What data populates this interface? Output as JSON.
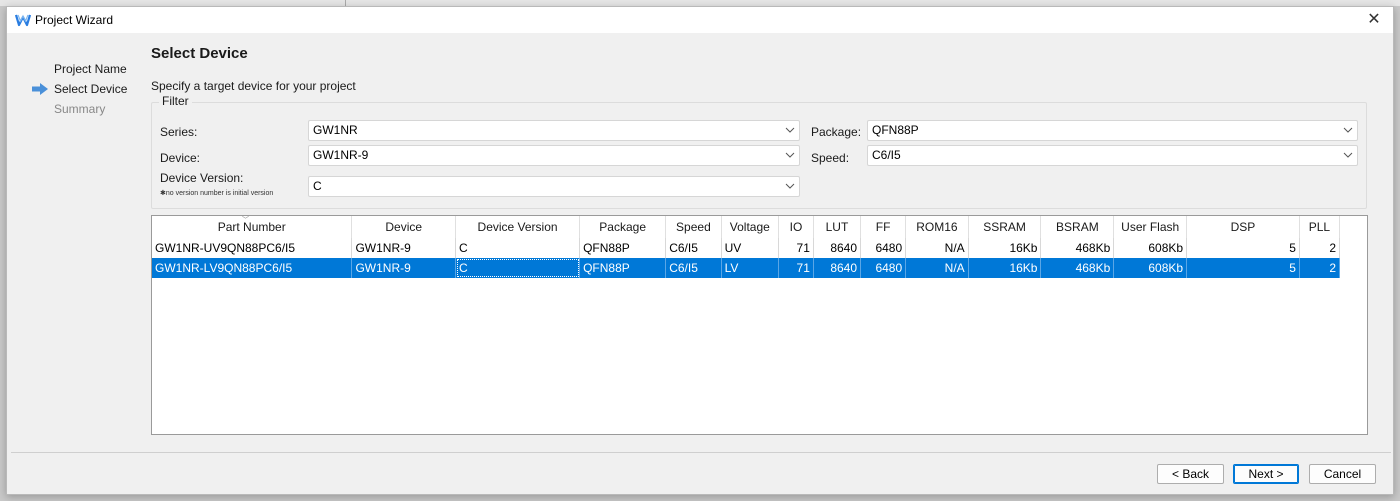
{
  "window": {
    "title": "Project Wizard",
    "close_glyph": "✕"
  },
  "steps": [
    {
      "label": "Project Name",
      "state": "done"
    },
    {
      "label": "Select Device",
      "state": "current"
    },
    {
      "label": "Summary",
      "state": "pending"
    }
  ],
  "page": {
    "title": "Select Device",
    "subtitle": "Specify a target device for your project"
  },
  "filter": {
    "legend": "Filter",
    "series_label": "Series:",
    "series_value": "GW1NR",
    "device_label": "Device:",
    "device_value": "GW1NR-9",
    "version_label": "Device Version:",
    "version_note": "no version number is initial version",
    "version_value": "C",
    "package_label": "Package:",
    "package_value": "QFN88P",
    "speed_label": "Speed:",
    "speed_value": "C6/I5"
  },
  "table": {
    "columns": [
      "Part Number",
      "Device",
      "Device Version",
      "Package",
      "Speed",
      "Voltage",
      "IO",
      "LUT",
      "FF",
      "ROM16",
      "SSRAM",
      "BSRAM",
      "User Flash",
      "DSP",
      "PLL"
    ],
    "rows": [
      [
        "GW1NR-UV9QN88PC6/I5",
        "GW1NR-9",
        "C",
        "QFN88P",
        "C6/I5",
        "UV",
        "71",
        "8640",
        "6480",
        "N/A",
        "16Kb",
        "468Kb",
        "608Kb",
        "5",
        "2"
      ],
      [
        "GW1NR-LV9QN88PC6/I5",
        "GW1NR-9",
        "C",
        "QFN88P",
        "C6/I5",
        "LV",
        "71",
        "8640",
        "6480",
        "N/A",
        "16Kb",
        "468Kb",
        "608Kb",
        "5",
        "2"
      ]
    ],
    "selected_row": 1
  },
  "buttons": {
    "back": "< Back",
    "next": "Next >",
    "cancel": "Cancel"
  },
  "colors": {
    "selection": "#0078d7",
    "window_bg": "#f0f0f0",
    "step_arrow": "#4a90d9"
  }
}
